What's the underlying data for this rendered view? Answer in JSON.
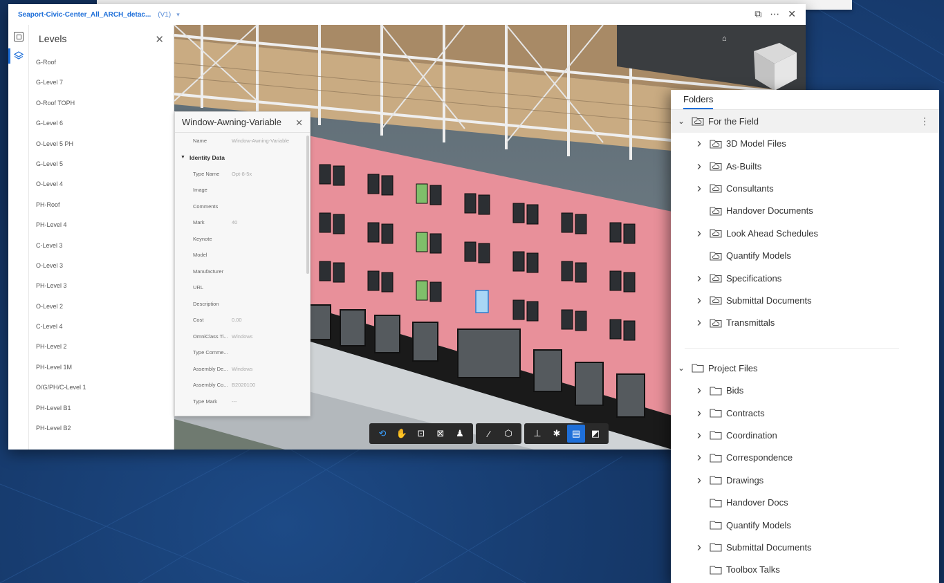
{
  "viewer": {
    "doc_title": "Seaport-Civic-Center_All_ARCH_detac...",
    "version": "(V1)",
    "levels_title": "Levels",
    "levels": [
      "G-Roof",
      "G-Level 7",
      "O-Roof TOPH",
      "G-Level 6",
      "O-Level 5 PH",
      "G-Level 5",
      "O-Level 4",
      "PH-Roof",
      "PH-Level 4",
      "C-Level 3",
      "O-Level 3",
      "PH-Level 3",
      "O-Level 2",
      "C-Level 4",
      "PH-Level 2",
      "PH-Level 1M",
      "O/G/PH/C-Level 1",
      "PH-Level B1",
      "PH-Level B2"
    ]
  },
  "properties": {
    "title": "Window-Awning-Variable",
    "name_key": "Name",
    "name_value": "Window-Awning-Variable",
    "group": "Identity Data",
    "rows": [
      {
        "k": "Type Name",
        "v": "Opt-8-5x"
      },
      {
        "k": "Image",
        "v": ""
      },
      {
        "k": "Comments",
        "v": ""
      },
      {
        "k": "Mark",
        "v": "40"
      },
      {
        "k": "Keynote",
        "v": ""
      },
      {
        "k": "Model",
        "v": ""
      },
      {
        "k": "Manufacturer",
        "v": ""
      },
      {
        "k": "URL",
        "v": ""
      },
      {
        "k": "Description",
        "v": ""
      },
      {
        "k": "Cost",
        "v": "0.00"
      },
      {
        "k": "OmniClass Ti...",
        "v": "Windows"
      },
      {
        "k": "Type Comme...",
        "v": ""
      },
      {
        "k": "Assembly De...",
        "v": "Windows"
      },
      {
        "k": "Assembly Co...",
        "v": "B2020100"
      },
      {
        "k": "Type Mark",
        "v": "---"
      }
    ]
  },
  "folders": {
    "tab": "Folders",
    "for_the_field": {
      "label": "For the Field",
      "children": [
        {
          "label": "3D Model Files",
          "expandable": true
        },
        {
          "label": "As-Builts",
          "expandable": true
        },
        {
          "label": "Consultants",
          "expandable": true
        },
        {
          "label": "Handover Documents",
          "expandable": false
        },
        {
          "label": "Look Ahead Schedules",
          "expandable": true
        },
        {
          "label": "Quantify Models",
          "expandable": false
        },
        {
          "label": "Specifications",
          "expandable": true
        },
        {
          "label": "Submittal Documents",
          "expandable": true
        },
        {
          "label": "Transmittals",
          "expandable": true
        }
      ]
    },
    "project_files": {
      "label": "Project Files",
      "children": [
        {
          "label": "Bids",
          "expandable": true
        },
        {
          "label": "Contracts",
          "expandable": true
        },
        {
          "label": "Coordination",
          "expandable": true
        },
        {
          "label": "Correspondence",
          "expandable": true
        },
        {
          "label": "Drawings",
          "expandable": true
        },
        {
          "label": "Handover Docs",
          "expandable": false
        },
        {
          "label": "Quantify Models",
          "expandable": false
        },
        {
          "label": "Submittal Documents",
          "expandable": true
        },
        {
          "label": "Toolbox Talks",
          "expandable": false
        }
      ]
    }
  },
  "toolbar": {
    "groups": [
      [
        "orbit-icon",
        "pan-icon",
        "fit-to-view-icon",
        "zoom-window-icon",
        "first-person-icon"
      ],
      [
        "measure-icon",
        "section-box-icon"
      ],
      [
        "model-browser-icon",
        "settings-icon",
        "properties-icon",
        "fullscreen-icon"
      ]
    ]
  },
  "colors": {
    "accent": "#1e6fd9",
    "facade": "#e8909a",
    "background": "#12305c"
  }
}
